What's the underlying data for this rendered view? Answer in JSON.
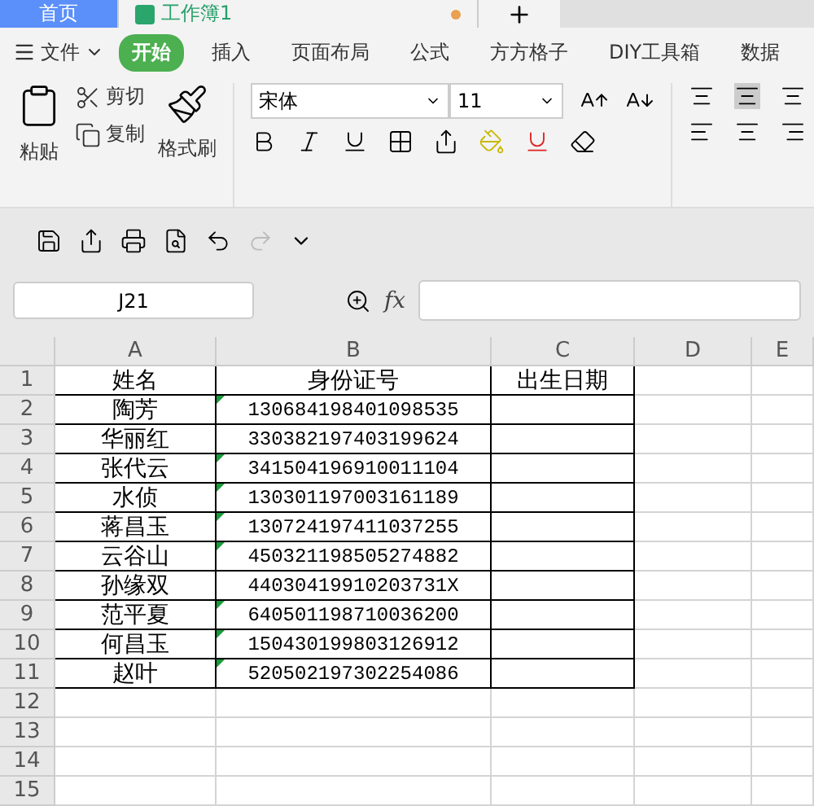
{
  "doc_tabs": [
    {
      "label": "首页",
      "kind": "home",
      "selected": false
    },
    {
      "label": "工作簿1",
      "kind": "doc",
      "selected": true
    }
  ],
  "menu": {
    "file": "文件",
    "tabs": [
      {
        "label": "开始",
        "selected": true
      },
      {
        "label": "插入",
        "selected": false
      },
      {
        "label": "页面布局",
        "selected": false
      },
      {
        "label": "公式",
        "selected": false
      },
      {
        "label": "方方格子",
        "selected": false
      },
      {
        "label": "DIY工具箱",
        "selected": false
      },
      {
        "label": "数据",
        "selected": false
      }
    ]
  },
  "ribbon": {
    "paste": "粘贴",
    "cut": "剪切",
    "copy": "复制",
    "format_painter": "格式刷",
    "font": "宋体",
    "size": "11"
  },
  "name_box": "J21",
  "fx": "fx",
  "columns": [
    "A",
    "B",
    "C",
    "D",
    "E"
  ],
  "rows": [
    {
      "n": "1",
      "a": "姓名",
      "b": "身份证号",
      "c": "出生日期",
      "flag": false
    },
    {
      "n": "2",
      "a": "陶芳",
      "b": "130684198401098535",
      "flag": true
    },
    {
      "n": "3",
      "a": "华丽红",
      "b": "330382197403199624",
      "flag": false
    },
    {
      "n": "4",
      "a": "张代云",
      "b": "341504196910011104",
      "flag": true
    },
    {
      "n": "5",
      "a": "水侦",
      "b": "130301197003161189",
      "flag": true
    },
    {
      "n": "6",
      "a": "蒋昌玉",
      "b": "130724197411037255",
      "flag": true
    },
    {
      "n": "7",
      "a": "云谷山",
      "b": "450321198505274882",
      "flag": true
    },
    {
      "n": "8",
      "a": "孙缘双",
      "b": "44030419910203731X",
      "flag": false
    },
    {
      "n": "9",
      "a": "范平夏",
      "b": "640501198710036200",
      "flag": true
    },
    {
      "n": "10",
      "a": "何昌玉",
      "b": "150430199803126912",
      "flag": true
    },
    {
      "n": "11",
      "a": "赵叶",
      "b": "520502197302254086",
      "flag": true
    },
    {
      "n": "12"
    },
    {
      "n": "13"
    },
    {
      "n": "14"
    },
    {
      "n": "15"
    }
  ]
}
